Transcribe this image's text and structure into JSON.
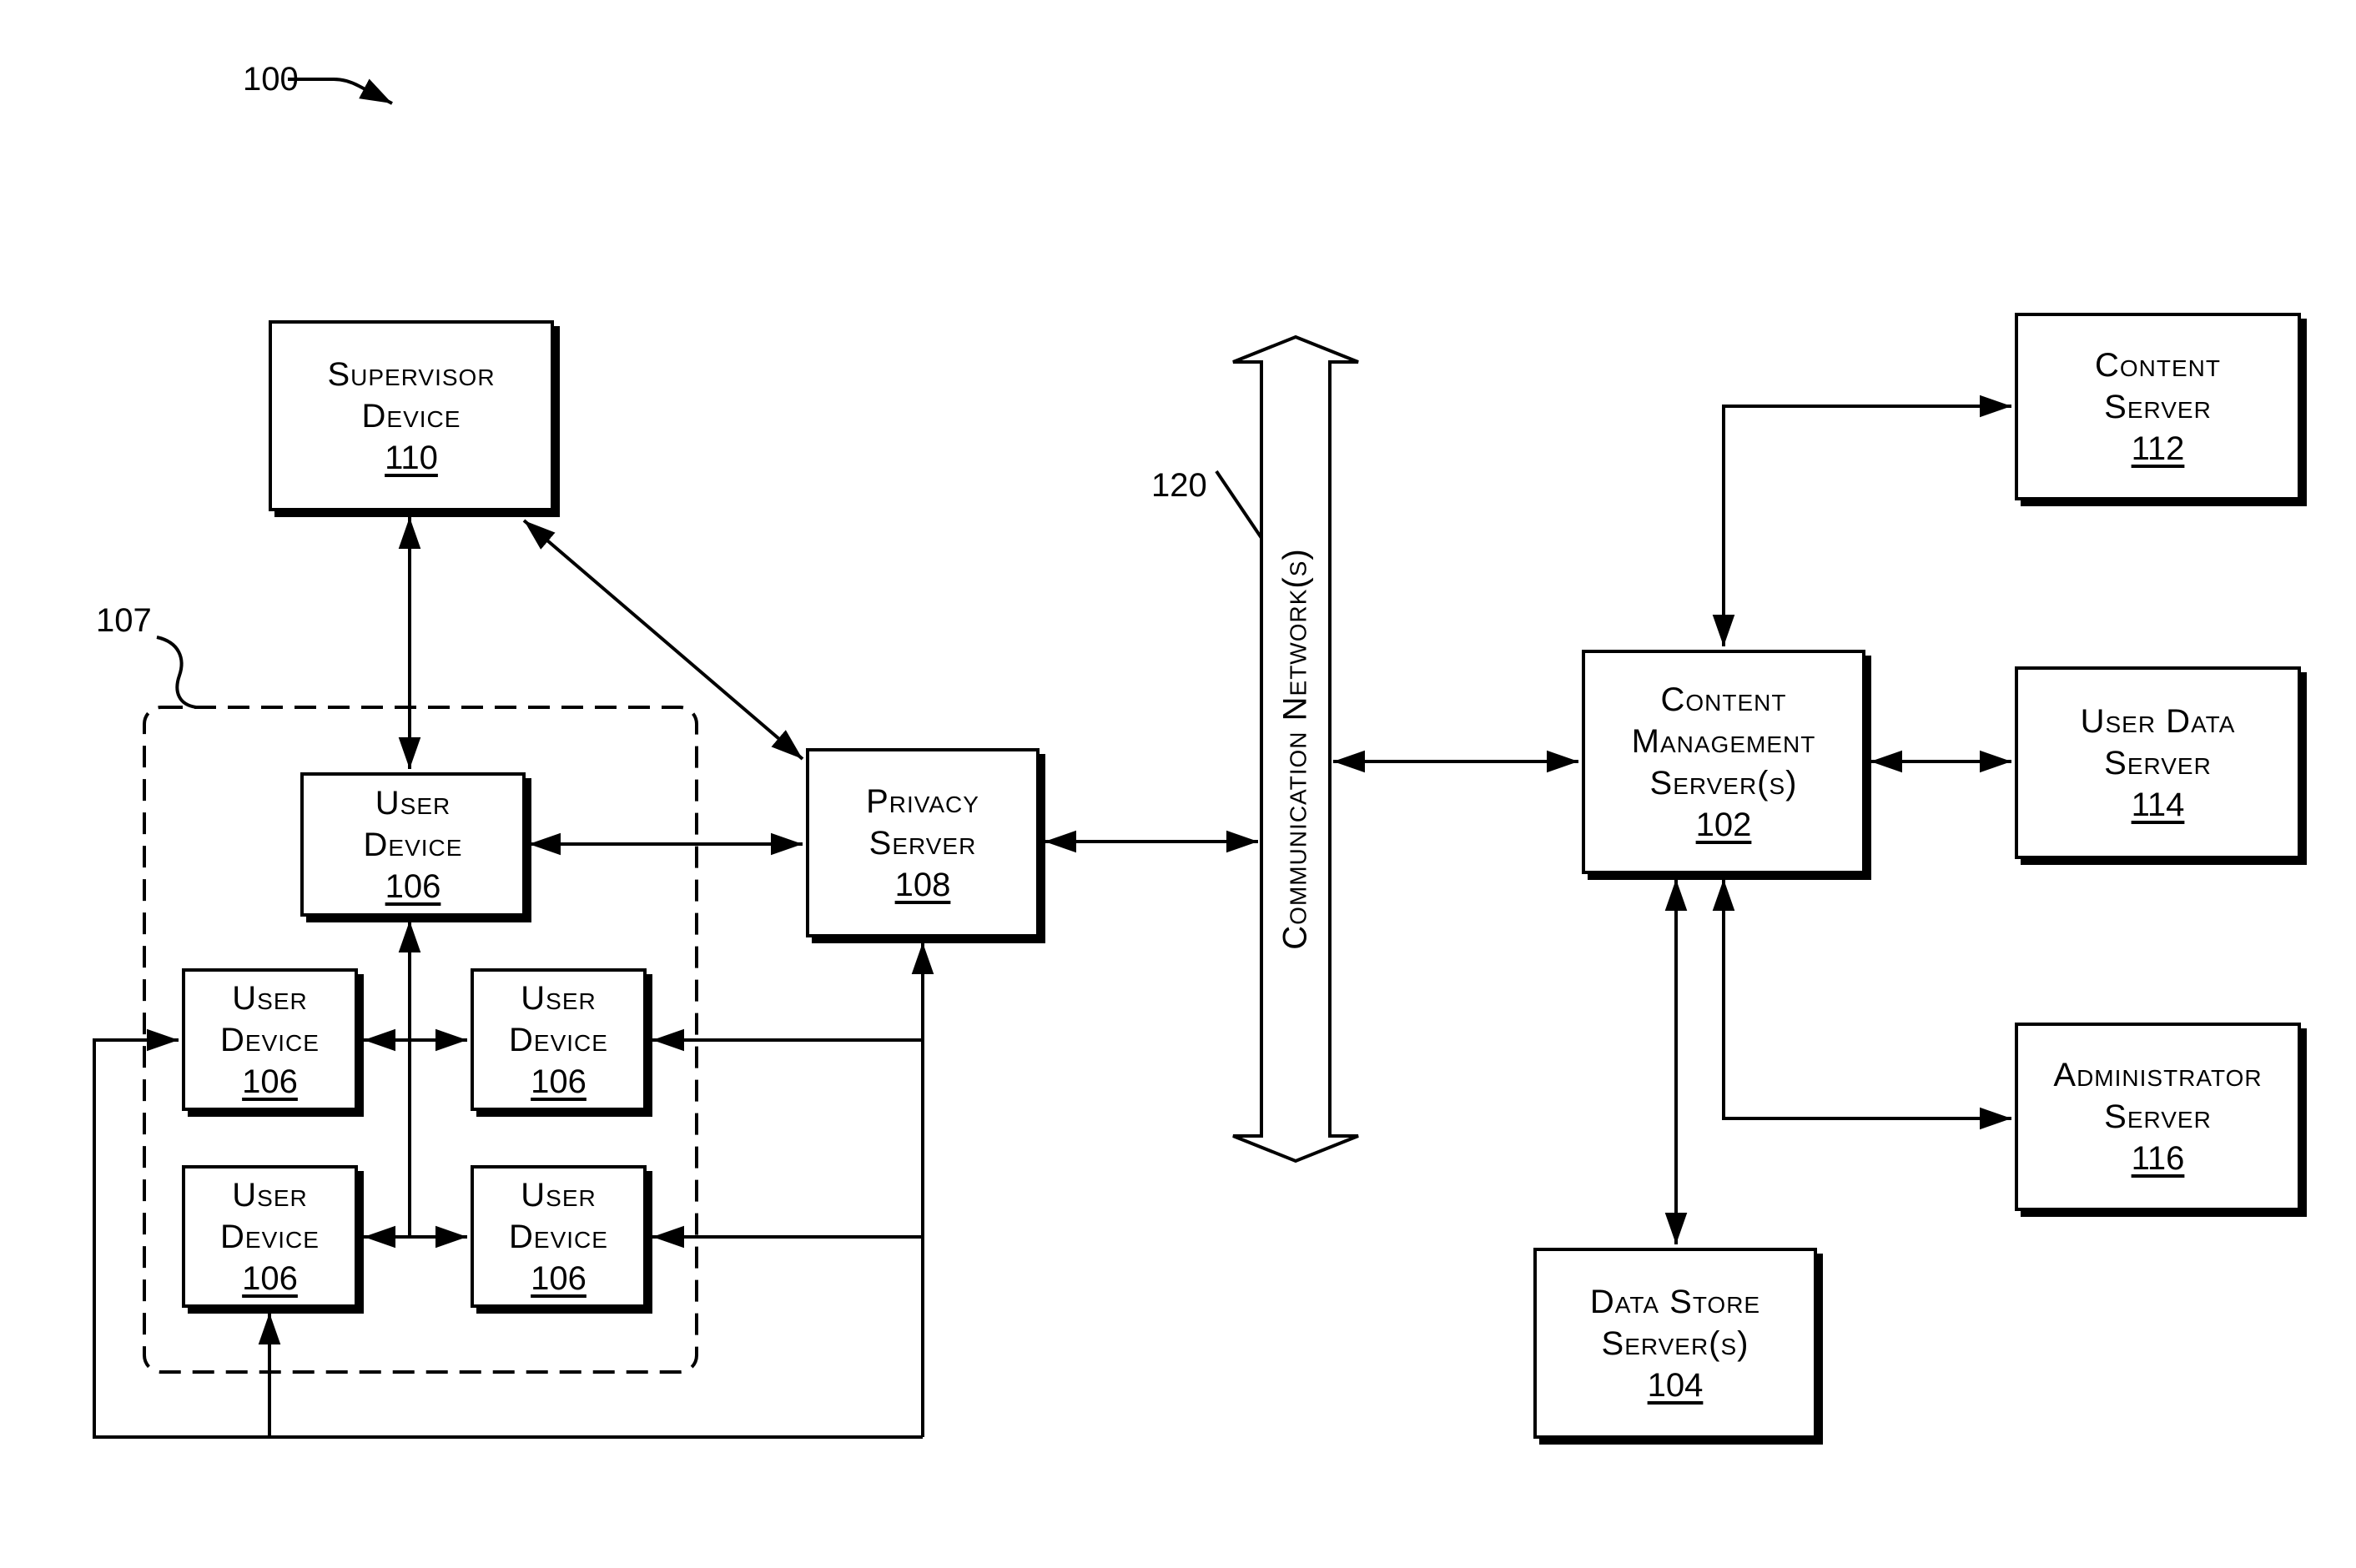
{
  "figure": {
    "ref_main": "100",
    "ref_group": "107",
    "ref_network": "120"
  },
  "network": {
    "label": "Communication Network(s)"
  },
  "nodes": {
    "supervisor": {
      "line1": "Supervisor",
      "line2": "Device",
      "num": "110"
    },
    "user_top": {
      "line1": "User",
      "line2": "Device",
      "num": "106"
    },
    "user_mid_left": {
      "line1": "User",
      "line2": "Device",
      "num": "106"
    },
    "user_mid_right": {
      "line1": "User",
      "line2": "Device",
      "num": "106"
    },
    "user_bot_left": {
      "line1": "User",
      "line2": "Device",
      "num": "106"
    },
    "user_bot_right": {
      "line1": "User",
      "line2": "Device",
      "num": "106"
    },
    "privacy": {
      "line1": "Privacy",
      "line2": "Server",
      "num": "108"
    },
    "cms": {
      "line1": "Content",
      "line2": "Management",
      "line3": "Server(s)",
      "num": "102"
    },
    "content": {
      "line1": "Content",
      "line2": "Server",
      "num": "112"
    },
    "userdata": {
      "line1": "User Data",
      "line2": "Server",
      "num": "114"
    },
    "admin": {
      "line1": "Administrator",
      "line2": "Server",
      "num": "116"
    },
    "datastore": {
      "line1": "Data Store",
      "line2": "Server(s)",
      "num": "104"
    }
  }
}
